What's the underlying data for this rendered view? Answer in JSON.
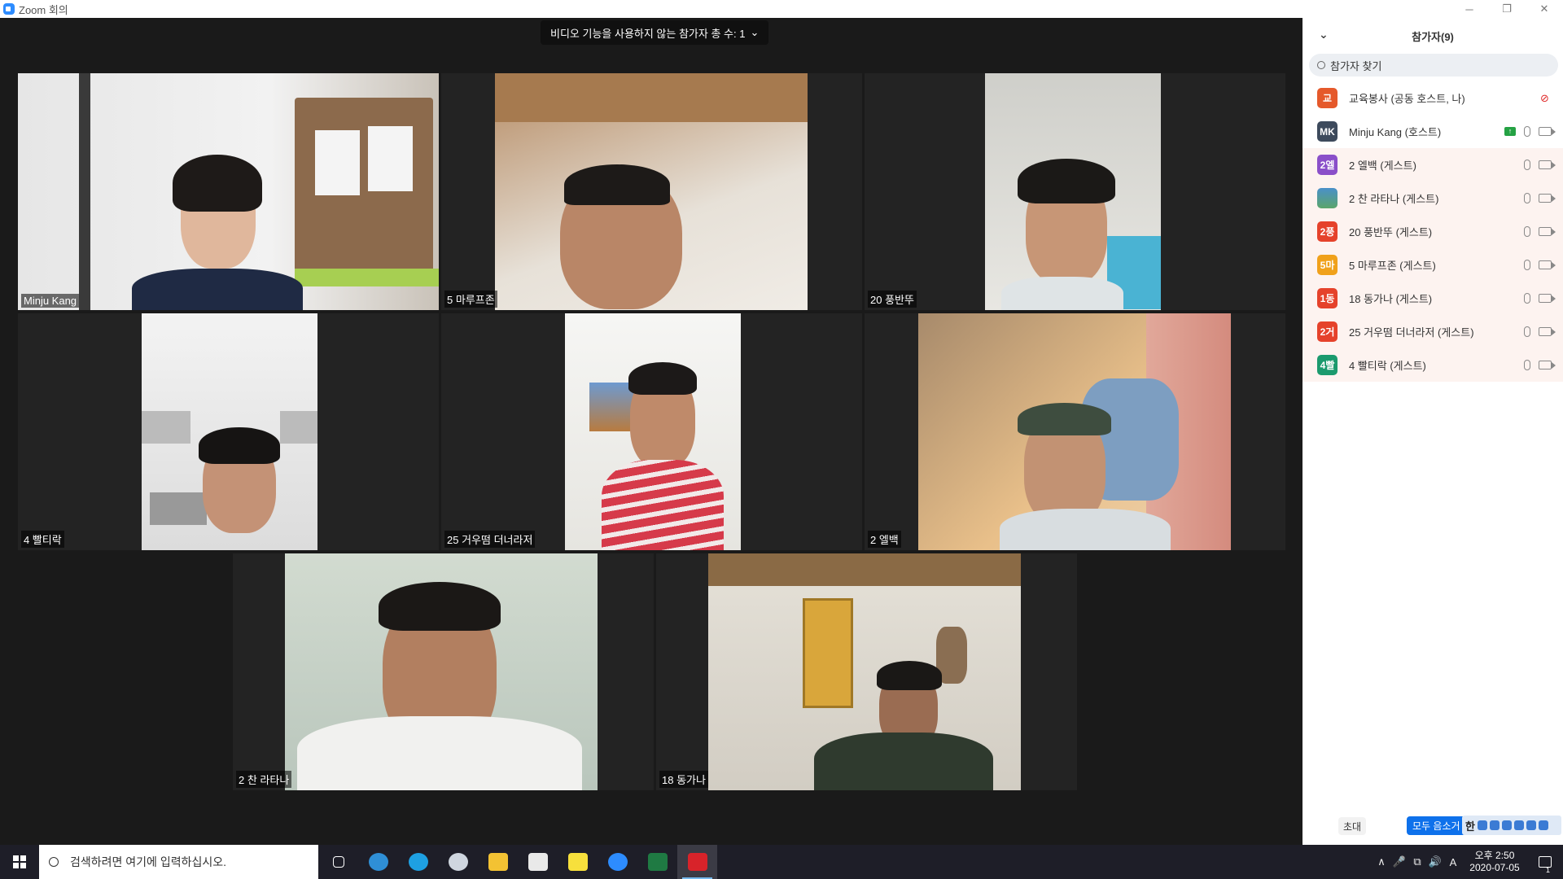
{
  "window": {
    "title": "Zoom 회의",
    "controls": [
      "─",
      "❐",
      "✕"
    ]
  },
  "video_banner": {
    "label": "비디오 기능을 사용하지 않는 참가자 총 수: 1",
    "chevron": "⌄"
  },
  "tiles": [
    {
      "name": "Minju Kang"
    },
    {
      "name": "5 마루프존"
    },
    {
      "name": "20 풍반뚜"
    },
    {
      "name": "4 빨티락"
    },
    {
      "name": "25 거우떰 더너라저"
    },
    {
      "name": "2 엘백"
    },
    {
      "name": "2 찬 라타나"
    },
    {
      "name": "18 동가나"
    }
  ],
  "panel": {
    "title": "참가자(9)",
    "search_placeholder": "참가자 찾기",
    "participants": [
      {
        "avatar": "교",
        "color": "#e5592b",
        "name": "교육봉사 (공동 호스트, 나)"
      },
      {
        "avatar": "MK",
        "color": "#3d4a5c",
        "name": "Minju Kang (호스트)"
      },
      {
        "avatar": "2엘",
        "color": "#8a4fc9",
        "name": "2 엘백 (게스트)"
      },
      {
        "avatar": "",
        "color": "#4a90c9",
        "name": "2 찬 라타나 (게스트)"
      },
      {
        "avatar": "2풍",
        "color": "#e5422b",
        "name": "20 풍반뚜 (게스트)"
      },
      {
        "avatar": "5마",
        "color": "#f0a11b",
        "name": "5 마루프존 (게스트)"
      },
      {
        "avatar": "1동",
        "color": "#e5422b",
        "name": "18 동가나 (게스트)"
      },
      {
        "avatar": "2거",
        "color": "#e5422b",
        "name": "25 거우떰 더너라저 (게스트)"
      },
      {
        "avatar": "4빨",
        "color": "#1b9a6e",
        "name": "4 빨티락 (게스트)"
      }
    ],
    "invite_label": "초대",
    "mute_all_label": "모두 음소거",
    "ime_label": "한"
  },
  "taskbar": {
    "search_placeholder": "검색하려면 여기에 입력하십시오.",
    "apps": [
      {
        "icon": "task-view-icon",
        "color": "#ffffff"
      },
      {
        "icon": "edge-icon",
        "color": "#2f8fd6"
      },
      {
        "icon": "ie-icon",
        "color": "#1ea0e2"
      },
      {
        "icon": "paint-icon",
        "color": "#cfd6df"
      },
      {
        "icon": "folder-icon",
        "color": "#f3c233"
      },
      {
        "icon": "store-icon",
        "color": "#e9e9e9"
      },
      {
        "icon": "kakaotalk-icon",
        "color": "#f7e03c"
      },
      {
        "icon": "zoom-icon",
        "color": "#2d8cff"
      },
      {
        "icon": "excel-icon",
        "color": "#1f7a43"
      },
      {
        "icon": "acrobat-icon",
        "color": "#d8232a"
      }
    ],
    "tray_symbols": [
      "∧",
      "🎤",
      "⧉",
      "🔊",
      "A"
    ],
    "clock_time": "오후 2:50",
    "clock_date": "2020-07-05",
    "notif_count": "1"
  }
}
